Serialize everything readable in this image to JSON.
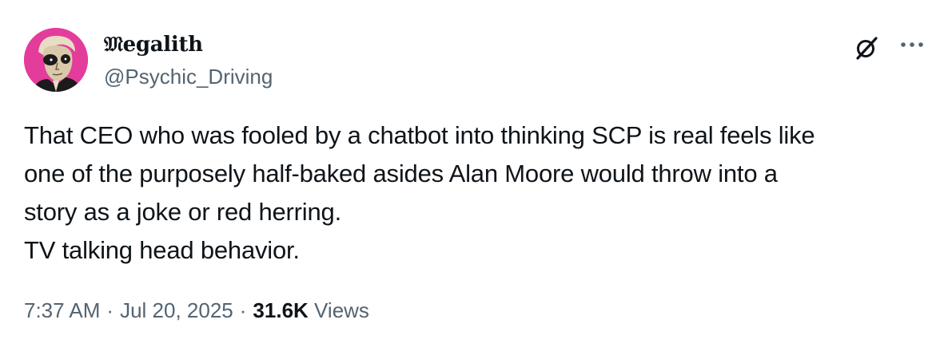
{
  "author": {
    "display_name": "𝔐egalith",
    "handle": "@Psychic_Driving",
    "avatar_icon": "avatar-image"
  },
  "actions": {
    "grok_icon": "grok-icon",
    "more_icon": "more-options-icon"
  },
  "tweet": {
    "lines": [
      "That CEO who was fooled by a chatbot into thinking SCP is real feels like",
      "one of the purposely half-baked asides Alan Moore would throw into a",
      "story as a joke or red herring.",
      "TV talking head behavior."
    ]
  },
  "meta": {
    "time": "7:37 AM",
    "separator": "·",
    "date": "Jul 20, 2025",
    "views_count": "31.6K",
    "views_label": "Views"
  },
  "colors": {
    "text_primary": "#0f1419",
    "text_secondary": "#536471",
    "avatar_bg": "#e33c9b"
  }
}
